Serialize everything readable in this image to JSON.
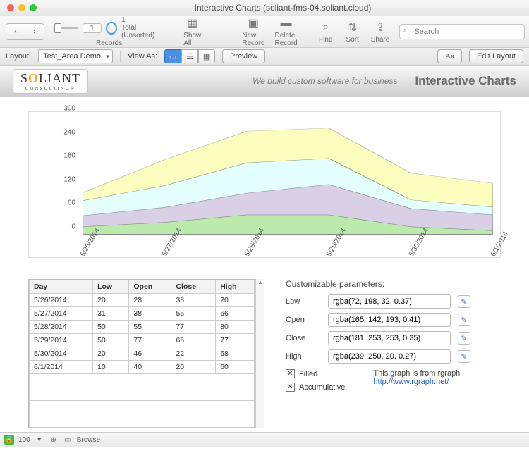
{
  "window": {
    "title": "Interactive Charts (soliant-fms-04.soliant.cloud)"
  },
  "toolbar": {
    "record_number": "1",
    "records_total": "1",
    "records_status": "Total (Unsorted)",
    "records_label": "Records",
    "show_all": "Show All",
    "new_record": "New Record",
    "delete_record": "Delete Record",
    "find": "Find",
    "sort": "Sort",
    "share": "Share",
    "search_placeholder": "Search"
  },
  "layoutbar": {
    "layout_label": "Layout:",
    "layout_value": "Test_Area Demo",
    "view_as": "View As:",
    "preview": "Preview",
    "text_format": "Aa",
    "edit_layout": "Edit Layout"
  },
  "header": {
    "logo_main_a": "S",
    "logo_main_b": "O",
    "logo_main_c": "LIANT",
    "logo_sub": "CONSULTING®",
    "tagline": "We build custom software for business",
    "app_title": "Interactive Charts"
  },
  "chart_data": {
    "type": "area",
    "categories": [
      "5/26/2014",
      "5/27/2014",
      "5/28/2014",
      "5/29/2014",
      "5/30/2014",
      "6/1/2014"
    ],
    "ylim": [
      0,
      300
    ],
    "yticks": [
      0,
      60,
      120,
      180,
      240,
      300
    ],
    "accumulative": true,
    "series": [
      {
        "name": "Low",
        "color": "rgba(72, 198, 32, 0.37)",
        "values": [
          20,
          31,
          50,
          50,
          20,
          10
        ]
      },
      {
        "name": "Open",
        "color": "rgba(165, 142, 193, 0.41)",
        "values": [
          28,
          38,
          55,
          77,
          46,
          40
        ]
      },
      {
        "name": "Close",
        "color": "rgba(181, 253, 253, 0.35)",
        "values": [
          38,
          55,
          77,
          66,
          22,
          20
        ]
      },
      {
        "name": "High",
        "color": "rgba(239, 250, 20, 0.27)",
        "values": [
          20,
          66,
          80,
          77,
          68,
          60
        ]
      }
    ],
    "cumulative_tops": {
      "low": [
        20,
        31,
        50,
        50,
        20,
        10
      ],
      "open": [
        48,
        69,
        105,
        127,
        66,
        50
      ],
      "close": [
        86,
        124,
        182,
        193,
        88,
        70
      ],
      "high": [
        106,
        190,
        262,
        270,
        156,
        130
      ]
    }
  },
  "table": {
    "headers": [
      "Day",
      "Low",
      "Open",
      "Close",
      "High"
    ],
    "rows": [
      [
        "5/26/2014",
        "20",
        "28",
        "38",
        "20"
      ],
      [
        "5/27/2014",
        "31",
        "38",
        "55",
        "66"
      ],
      [
        "5/28/2014",
        "50",
        "55",
        "77",
        "80"
      ],
      [
        "5/29/2014",
        "50",
        "77",
        "66",
        "77"
      ],
      [
        "5/30/2014",
        "20",
        "46",
        "22",
        "68"
      ],
      [
        "6/1/2014",
        "10",
        "40",
        "20",
        "60"
      ]
    ]
  },
  "params": {
    "heading": "Customizable parameters:",
    "fields": {
      "low": {
        "label": "Low",
        "value": "rgba(72, 198, 32, 0.37)"
      },
      "open": {
        "label": "Open",
        "value": "rgba(165, 142, 193, 0.41)"
      },
      "close": {
        "label": "Close",
        "value": "rgba(181, 253, 253, 0.35)"
      },
      "high": {
        "label": "High",
        "value": "rgba(239, 250, 20, 0.27)"
      }
    },
    "filled_label": "Filled",
    "accumulative_label": "Accumulative",
    "credit_text": "This graph is from rgraph",
    "credit_url": "http://www.rgraph.net/"
  },
  "status": {
    "zoom": "100",
    "mode": "Browse"
  }
}
